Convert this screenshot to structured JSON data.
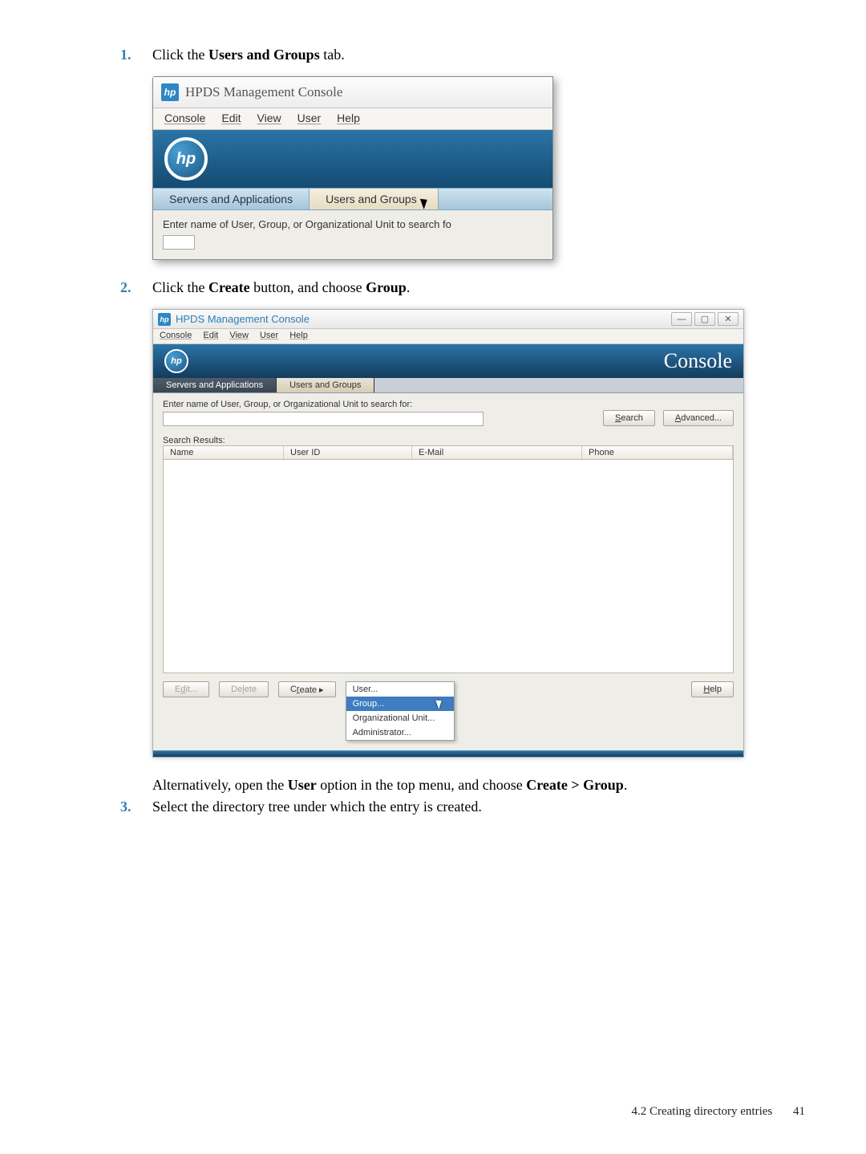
{
  "steps": {
    "one": {
      "num": "1.",
      "pre": "Click the ",
      "bold": "Users and Groups",
      "post": " tab."
    },
    "two": {
      "num": "2.",
      "pre": "Click the ",
      "bold1": "Create",
      "mid": " button, and choose ",
      "bold2": "Group",
      "post": "."
    },
    "alt": {
      "pre": "Alternatively, open the ",
      "b1": "User",
      "mid": " option in the top menu, and choose ",
      "b2": "Create > Group",
      "post": "."
    },
    "three": {
      "num": "3.",
      "text": "Select the directory tree under which the entry is created."
    }
  },
  "ss1": {
    "title": "HPDS Management Console",
    "menu": {
      "console": "Console",
      "edit": "Edit",
      "view": "View",
      "user": "User",
      "help": "Help"
    },
    "tabs": {
      "servers": "Servers and Applications",
      "users": "Users and Groups"
    },
    "searchLabel": "Enter name of User, Group, or Organizational Unit to search fo"
  },
  "ss2": {
    "title": "HPDS Management Console",
    "menu": {
      "console": "Console",
      "edit": "Edit",
      "view": "View",
      "user": "User",
      "help": "Help"
    },
    "bannerTitle": "Console",
    "tabs": {
      "servers": "Servers and Applications",
      "users": "Users and Groups"
    },
    "searchLabel": "Enter name of User, Group, or Organizational Unit to search for:",
    "buttons": {
      "search": "Search",
      "advanced": "Advanced...",
      "edit": "Edit...",
      "delete": "Delete",
      "create": "Create",
      "help": "Help"
    },
    "resultsLabel": "Search Results:",
    "columns": {
      "name": "Name",
      "uid": "User ID",
      "email": "E-Mail",
      "phone": "Phone"
    },
    "menuItems": {
      "user": "User...",
      "group": "Group...",
      "ou": "Organizational Unit...",
      "admin": "Administrator..."
    }
  },
  "footer": {
    "section": "4.2 Creating directory entries",
    "page": "41"
  }
}
